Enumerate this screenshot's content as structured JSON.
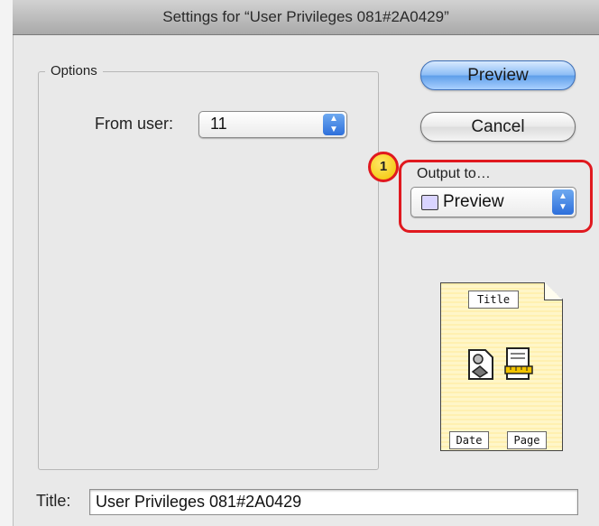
{
  "window": {
    "title": "Settings for “User Privileges 081#2A0429”"
  },
  "options_group": {
    "title": "Options",
    "from_user_label": "From user:",
    "from_user_value": "11"
  },
  "buttons": {
    "preview_label": "Preview",
    "cancel_label": "Cancel"
  },
  "output": {
    "label": "Output to…",
    "selected_value": "Preview"
  },
  "callout": {
    "number": "1",
    "color": "#e0191f"
  },
  "layout_preview": {
    "title_chip": "Title",
    "date_chip": "Date",
    "page_chip": "Page",
    "icons": [
      "document-icon",
      "ruler-page-icon"
    ]
  },
  "footer": {
    "title_label": "Title:",
    "title_value": "User Privileges 081#2A0429"
  }
}
